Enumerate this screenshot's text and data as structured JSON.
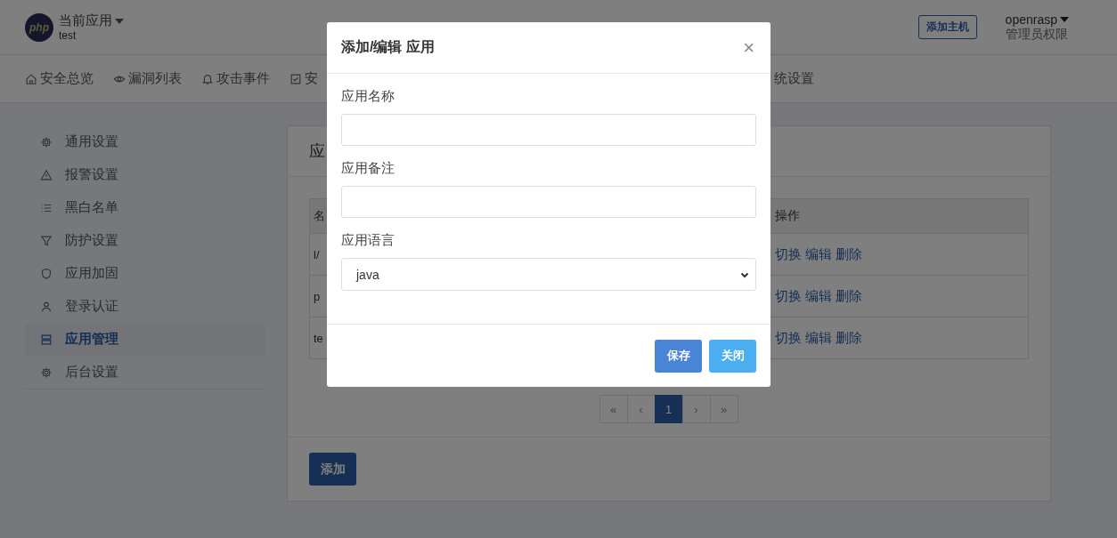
{
  "header": {
    "logo": "php",
    "app_switcher": "当前应用",
    "app_name": "test",
    "add_host_button": "添加主机",
    "user": "openrasp",
    "role": "管理员权限"
  },
  "nav": [
    {
      "label": "安全总览"
    },
    {
      "label": "漏洞列表"
    },
    {
      "label": "攻击事件"
    },
    {
      "label": "安"
    },
    {
      "label": "统设置"
    }
  ],
  "sidebar": [
    {
      "label": "通用设置",
      "selected": false
    },
    {
      "label": "报警设置",
      "selected": false
    },
    {
      "label": "黑白名单",
      "selected": false
    },
    {
      "label": "防护设置",
      "selected": false
    },
    {
      "label": "应用加固",
      "selected": false
    },
    {
      "label": "登录认证",
      "selected": false
    },
    {
      "label": "应用管理",
      "selected": true
    },
    {
      "label": "后台设置",
      "selected": false
    }
  ],
  "card": {
    "title": "应",
    "table": {
      "columns": [
        "名",
        "操作"
      ],
      "rows": [
        {
          "column_1": "l/",
          "actions": [
            "切换",
            "编辑",
            "删除"
          ]
        },
        {
          "column_1": "p",
          "actions": [
            "切换",
            "编辑",
            "删除"
          ]
        },
        {
          "column_1": "te",
          "actions": [
            "切换",
            "编辑",
            "删除"
          ]
        }
      ]
    },
    "pagination": [
      {
        "label": "«",
        "selected": false
      },
      {
        "label": "‹",
        "selected": false
      },
      {
        "label": "1",
        "selected": true
      },
      {
        "label": "›",
        "selected": false
      },
      {
        "label": "»",
        "selected": false
      }
    ],
    "add_button": "添加"
  },
  "modal": {
    "title": "添加/编辑 应用",
    "close": "×",
    "fields": [
      {
        "label": "应用名称",
        "kind": "text"
      },
      {
        "label": "应用备注",
        "kind": "text"
      },
      {
        "label": "应用语言",
        "kind": "select",
        "value": "java"
      }
    ],
    "buttons": [
      {
        "label": "保存",
        "kind": "primary"
      },
      {
        "label": "关闭",
        "kind": "info"
      }
    ]
  }
}
